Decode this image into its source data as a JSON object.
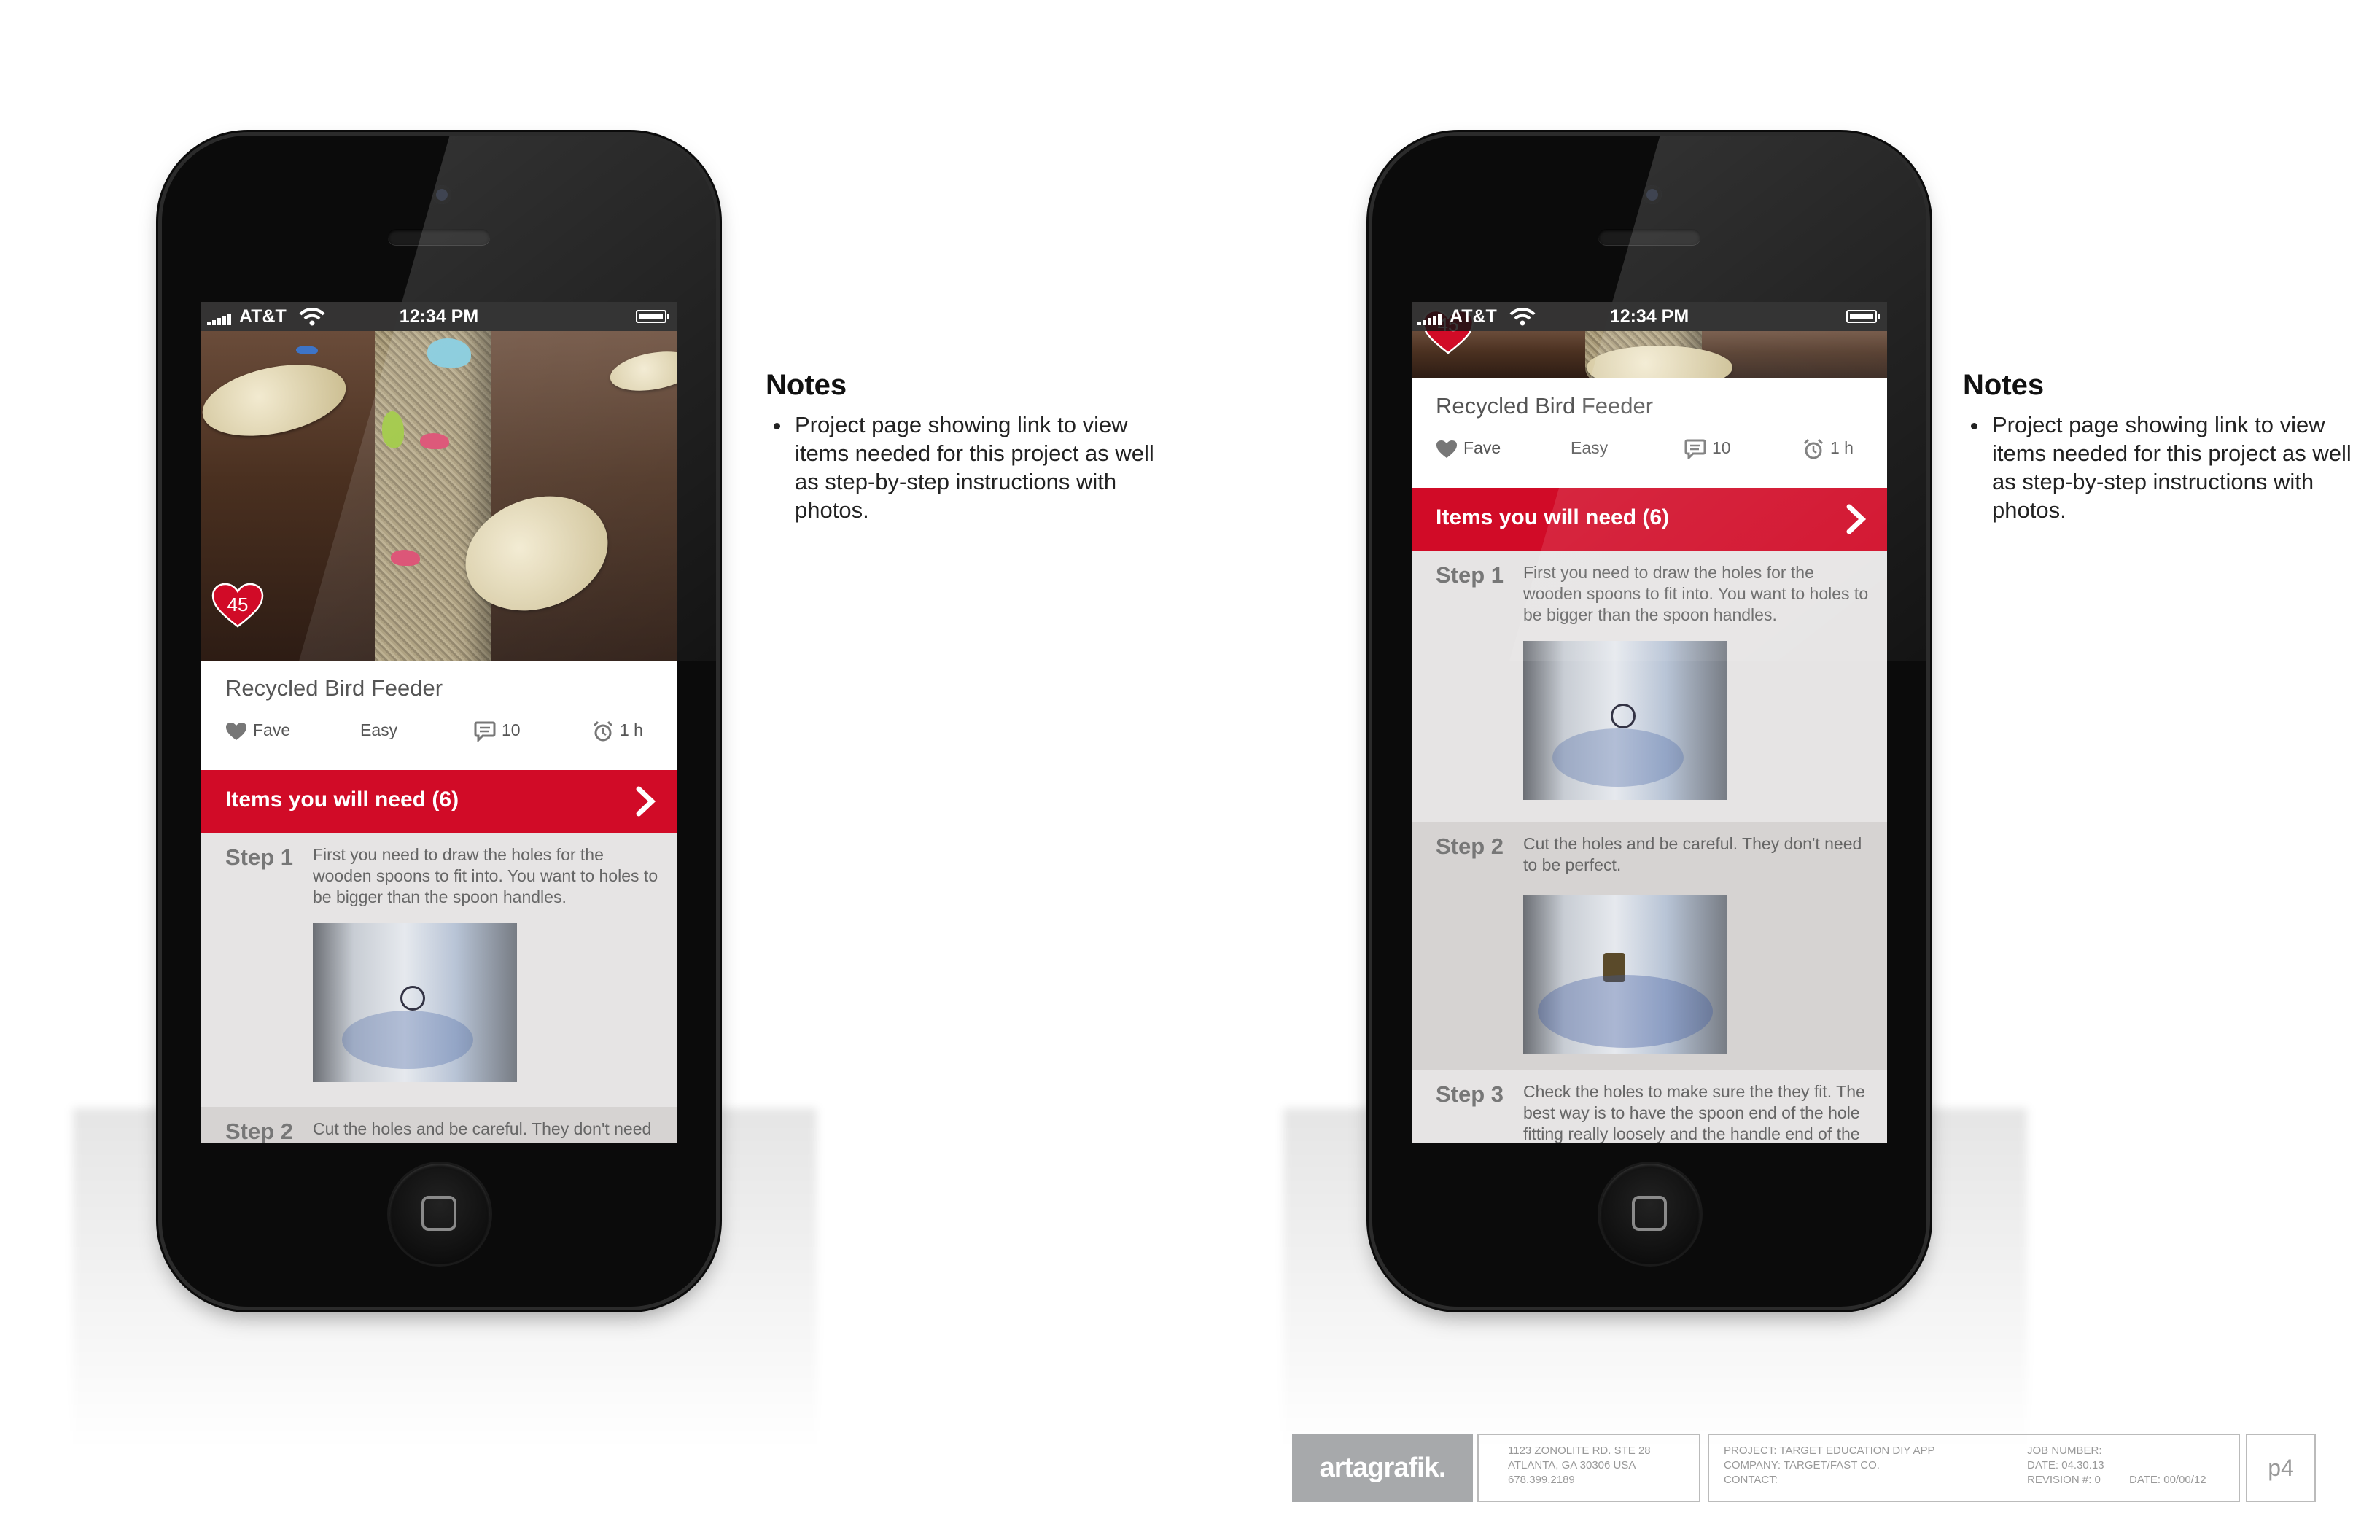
{
  "status_bar": {
    "carrier": "AT&T",
    "time": "12:34 PM"
  },
  "project": {
    "title": "Recycled Bird Feeder",
    "fave_count": "45",
    "fave_label": "Fave",
    "difficulty": "Easy",
    "comments": "10",
    "duration": "1 h"
  },
  "items_bar": {
    "label": "Items you will need (6)"
  },
  "steps": [
    {
      "label": "Step 1",
      "text": "First you need to draw the holes for the wooden spoons to fit into. You want to holes to be bigger than the spoon handles."
    },
    {
      "label": "Step 2",
      "text": "Cut the holes and be careful. They don't need to be perfect."
    },
    {
      "label": "Step 3",
      "text": "Check the holes to make sure the they fit. The best way is to have the spoon end of the hole fitting really loosely and the handle end of the hole to be a tight fit."
    }
  ],
  "notes": {
    "title": "Notes",
    "items": [
      "Project page showing link to view items needed for this project as well as step-by-step instructions with photos."
    ]
  },
  "footer": {
    "logo": "artagrafik.",
    "address": [
      "1123 ZONOLITE RD. STE 28",
      "ATLANTA, GA 30306 USA",
      "678.399.2189"
    ],
    "project": "PROJECT: TARGET EDUCATION DIY APP",
    "company": "COMPANY: TARGET/FAST CO.",
    "contact": "CONTACT:",
    "job_number": "JOB NUMBER:",
    "date": "DATE: 04.30.13",
    "revision": "REVISION #: 0",
    "rev_date": "DATE: 00/00/12",
    "page": "p4"
  },
  "colors": {
    "accent": "#d10b27",
    "step_bg": "#e6e4e4",
    "step_alt_bg": "#d6d3d2"
  }
}
